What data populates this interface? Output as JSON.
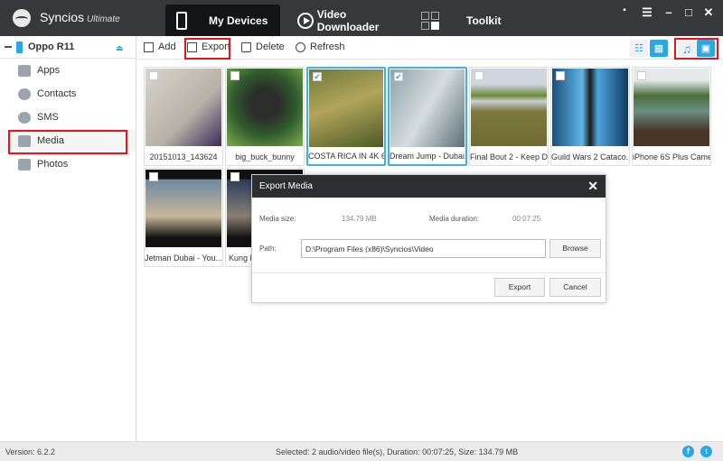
{
  "app": {
    "name": "Syncios",
    "edition": "Ultimate"
  },
  "nav": {
    "tabs": [
      {
        "label": "My Devices"
      },
      {
        "label": "Video Downloader"
      },
      {
        "label": "Toolkit"
      }
    ]
  },
  "window_controls": [
    "feedback",
    "menu",
    "minimize",
    "maximize",
    "close"
  ],
  "device": {
    "name": "Oppo R11"
  },
  "sidebar": {
    "items": [
      {
        "label": "Apps"
      },
      {
        "label": "Contacts"
      },
      {
        "label": "SMS"
      },
      {
        "label": "Media"
      },
      {
        "label": "Photos"
      }
    ]
  },
  "toolbar": {
    "add": "Add",
    "export": "Export",
    "delete": "Delete",
    "refresh": "Refresh"
  },
  "colors": {
    "accent": "#2aa8e0",
    "highlight": "#e8141b",
    "selected_border": "#3cb3e4"
  },
  "media": [
    {
      "title": "20151013_143624",
      "checked": false
    },
    {
      "title": "big_buck_bunny",
      "checked": false
    },
    {
      "title": "COSTA RICA IN 4K 6...",
      "checked": true
    },
    {
      "title": "Dream Jump - Dubai...",
      "checked": true
    },
    {
      "title": "Final Bout 2 - Keep D...",
      "checked": false
    },
    {
      "title": "Guild Wars 2 Cataco...",
      "checked": false
    },
    {
      "title": "iPhone 6S Plus Came...",
      "checked": false
    },
    {
      "title": "Jetman Dubai  - You...",
      "checked": false
    },
    {
      "title": "Kung F",
      "checked": false
    }
  ],
  "dialog": {
    "title": "Export Media",
    "size_label": "Media size:",
    "size_value": "134.79 MB",
    "duration_label": "Media duration:",
    "duration_value": "00:07:25",
    "path_label": "Path:",
    "path_value": "D:\\Program Files (x86)\\Syncios\\Video",
    "browse": "Browse",
    "export": "Export",
    "cancel": "Cancel"
  },
  "status": {
    "version": "Version: 6.2.2",
    "selection": "Selected: 2 audio/video file(s), Duration: 00:07:25, Size: 134.79 MB"
  }
}
